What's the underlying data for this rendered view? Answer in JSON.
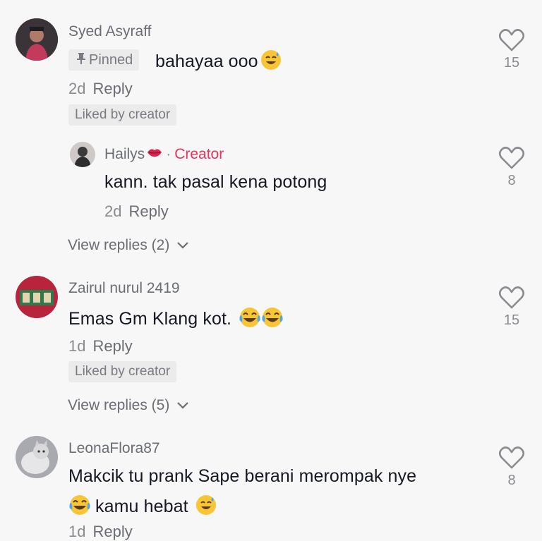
{
  "comments": [
    {
      "username": "Syed Asyraff",
      "pinned_label": "Pinned",
      "text": "bahayaa ooo",
      "time": "2d",
      "reply_label": "Reply",
      "liked_by_creator": "Liked by creator",
      "likes": "15",
      "avatar_colors": [
        "#2a2a2e",
        "#c23b5a"
      ]
    },
    {
      "username": "Hailys",
      "creator_label": "Creator",
      "text": "kann. tak pasal kena potong",
      "time": "2d",
      "reply_label": "Reply",
      "likes": "8"
    },
    {
      "view_replies": "View replies (2)"
    },
    {
      "username": "Zairul nurul 2419",
      "text": "Emas Gm Klang kot.",
      "time": "1d",
      "reply_label": "Reply",
      "liked_by_creator": "Liked by creator",
      "likes": "15",
      "view_replies": "View replies (5)"
    },
    {
      "username": "LeonaFlora87",
      "text_line1": "Makcik tu prank Sape berani merompak nye",
      "text_line2": "kamu hebat",
      "time": "1d",
      "reply_label": "Reply",
      "likes": "8"
    }
  ],
  "colors": {
    "background": "#f7f7f7",
    "creator_accent": "#e8335a",
    "muted_text": "#8a8b91",
    "pill_bg": "#ebebeb"
  },
  "icons": [
    "heart-outline-icon",
    "pin-icon",
    "chevron-down-icon",
    "sweat-smile-emoji",
    "joy-emoji",
    "lips-emoji"
  ]
}
